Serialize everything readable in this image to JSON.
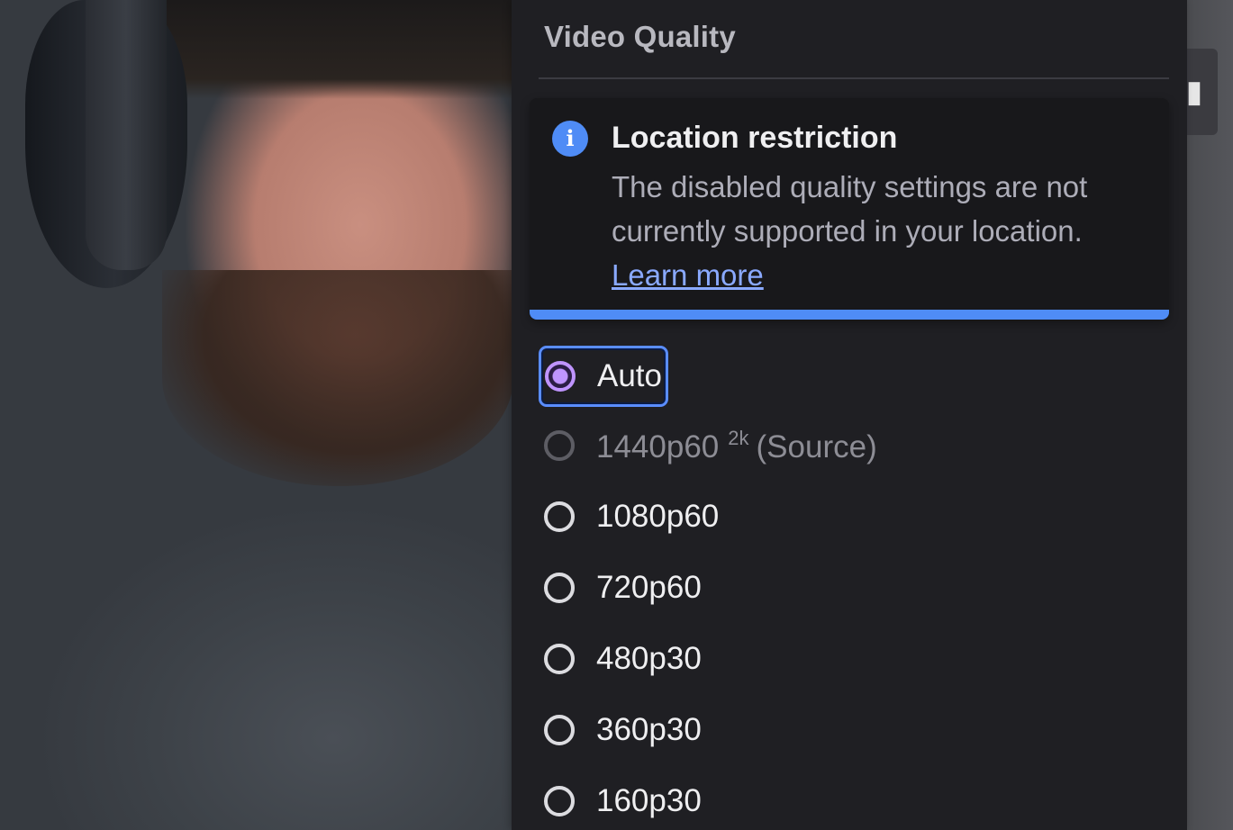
{
  "panel": {
    "title": "Video Quality"
  },
  "notice": {
    "icon": "info-icon",
    "title": "Location restriction",
    "body": "The disabled quality settings are not currently supported in your location.",
    "link": "Learn more",
    "accent": "#4f8cf6"
  },
  "qualities": [
    {
      "label": "Auto",
      "selected": true,
      "disabled": false
    },
    {
      "label": "1440p60",
      "badge": "2k",
      "suffix": "(Source)",
      "selected": false,
      "disabled": true
    },
    {
      "label": "1080p60",
      "selected": false,
      "disabled": false
    },
    {
      "label": "720p60",
      "selected": false,
      "disabled": false
    },
    {
      "label": "480p30",
      "selected": false,
      "disabled": false
    },
    {
      "label": "360p30",
      "selected": false,
      "disabled": false
    },
    {
      "label": "160p30",
      "selected": false,
      "disabled": false
    }
  ],
  "colors": {
    "panel_bg": "#1f1f23",
    "selected_radio": "#bf94ff",
    "focus_ring": "#5a8dff"
  },
  "side_button": {
    "icon": "settings-partial-icon"
  }
}
